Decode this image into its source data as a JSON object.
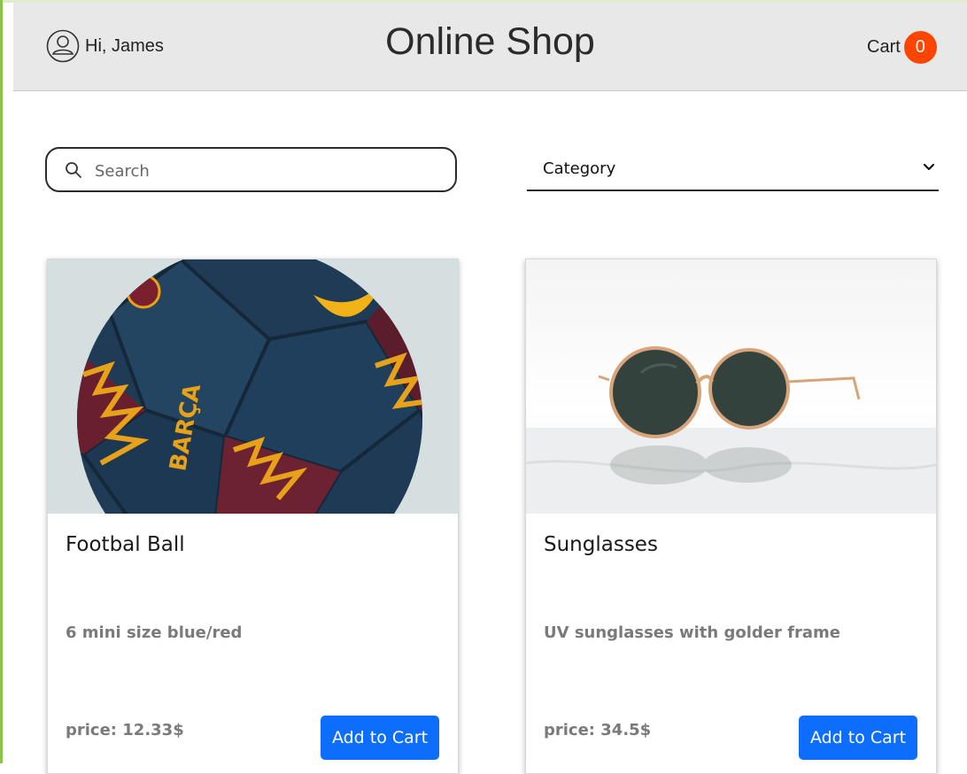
{
  "header": {
    "greeting": "Hi, James",
    "title": "Online Shop",
    "cart_label": "Cart",
    "cart_count": "0"
  },
  "filters": {
    "search_placeholder": "Search",
    "category_label": "Category"
  },
  "products": [
    {
      "name": "Footbal Ball",
      "description": "6 mini size blue/red",
      "price": "price: 12.33$",
      "button_label": "Add to Cart",
      "image": "football-ball-image"
    },
    {
      "name": "Sunglasses",
      "description": "UV sunglasses with golder frame",
      "price": "price: 34.5$",
      "button_label": "Add to Cart",
      "image": "sunglasses-image"
    }
  ],
  "colors": {
    "header_bg": "#e8e8e8",
    "cart_badge": "#ff4500",
    "button_primary": "#0d6efd",
    "muted_text": "#7a7a7a"
  }
}
